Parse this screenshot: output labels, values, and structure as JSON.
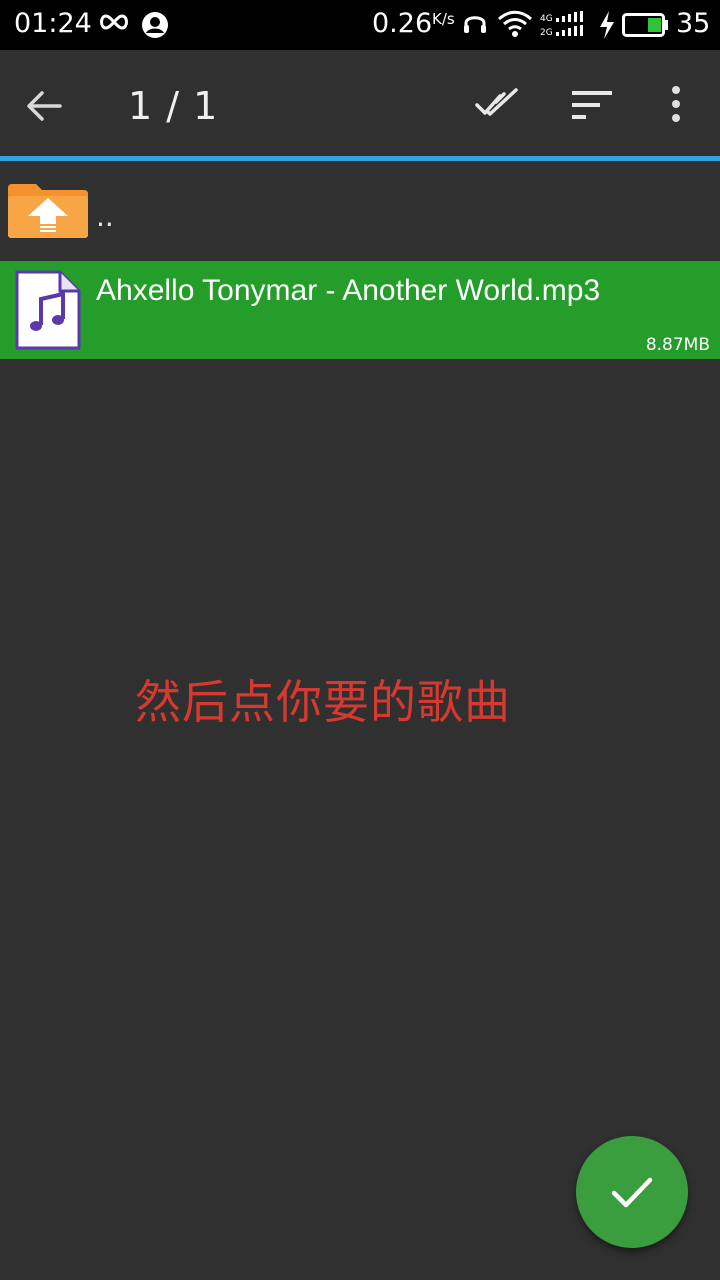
{
  "status_bar": {
    "time": "01:24",
    "net_speed": "0.26",
    "net_speed_unit": "K/s",
    "network_types": [
      "4G",
      "2G"
    ],
    "battery": "35",
    "icons": [
      "infinity-icon",
      "user-icon",
      "headset-icon",
      "wifi-icon",
      "signal-icon",
      "charging-icon",
      "battery-icon"
    ]
  },
  "toolbar": {
    "title": "1 / 1",
    "icons": [
      "back-arrow-icon",
      "select-all-icon",
      "sort-icon",
      "more-vert-icon"
    ]
  },
  "file_list": {
    "items": [
      {
        "name": "..",
        "type": "parent-folder",
        "icon": "folder-up-icon"
      },
      {
        "name": "Ahxello Tonymar - Another World.mp3",
        "size": "8.87MB",
        "type": "audio",
        "icon": "music-file-icon",
        "selected": true
      }
    ]
  },
  "annotation": "然后点你要的歌曲",
  "fab": {
    "icon": "check-icon"
  },
  "colors": {
    "background": "#303030",
    "status_bar": "#000000",
    "accent_line": "#33a3e0",
    "selected_row": "#259d2b",
    "fab": "#3a9e3e",
    "annotation_text": "#d6392f",
    "folder": "#f4922e"
  }
}
